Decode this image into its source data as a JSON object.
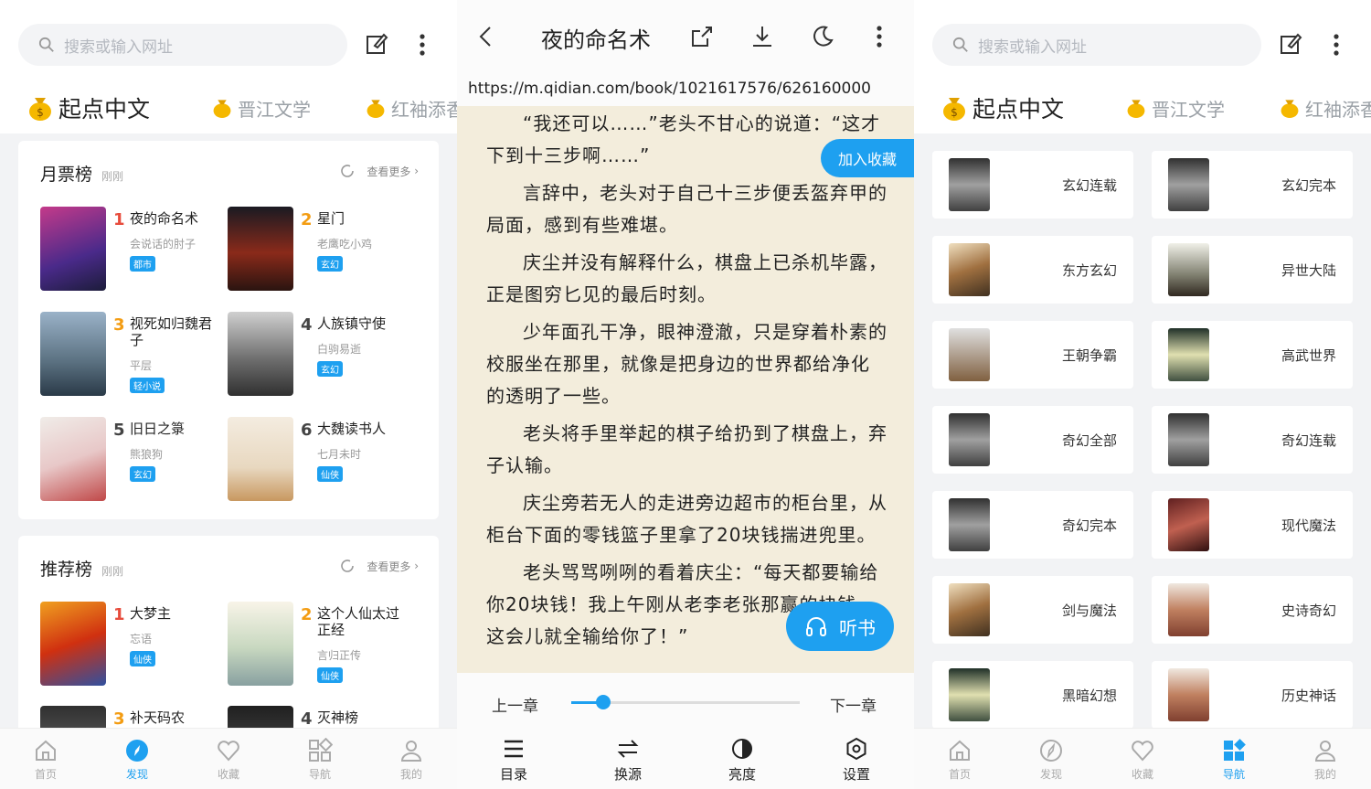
{
  "panel1": {
    "search_placeholder": "搜索或输入网址",
    "sources": [
      "起点中文",
      "晋江文学",
      "红袖添香"
    ],
    "monthly": {
      "title": "月票榜",
      "time": "刚刚",
      "more": "查看更多",
      "books": [
        {
          "rank": "1",
          "title": "夜的命名术",
          "author": "会说话的肘子",
          "tag": "都市"
        },
        {
          "rank": "2",
          "title": "星门",
          "author": "老鹰吃小鸡",
          "tag": "玄幻"
        },
        {
          "rank": "3",
          "title": "视死如归魏君子",
          "author": "平层",
          "tag": "轻小说"
        },
        {
          "rank": "4",
          "title": "人族镇守使",
          "author": "白驹易逝",
          "tag": "玄幻"
        },
        {
          "rank": "5",
          "title": "旧日之箓",
          "author": "熊狼狗",
          "tag": "玄幻"
        },
        {
          "rank": "6",
          "title": "大魏读书人",
          "author": "七月未时",
          "tag": "仙侠"
        }
      ]
    },
    "recommend": {
      "title": "推荐榜",
      "time": "刚刚",
      "more": "查看更多",
      "books": [
        {
          "rank": "1",
          "title": "大梦主",
          "author": "忘语",
          "tag": "仙侠"
        },
        {
          "rank": "2",
          "title": "这个人仙太过正经",
          "author": "言归正传",
          "tag": "仙侠"
        },
        {
          "rank": "3",
          "title": "补天码农",
          "author": "",
          "tag": ""
        },
        {
          "rank": "4",
          "title": "灭神榜",
          "author": "",
          "tag": ""
        }
      ]
    },
    "nav": [
      "首页",
      "发现",
      "收藏",
      "导航",
      "我的"
    ]
  },
  "panel2": {
    "title": "夜的命名术",
    "url": "https://m.qidian.com/book/1021617576/626160000",
    "paragraphs": [
      "“我还可以……”老头不甘心的说道：“这才下到十三步啊……”",
      "言辞中，老头对于自己十三步便丢盔弃甲的局面，感到有些难堪。",
      "庆尘并没有解释什么，棋盘上已杀机毕露，正是图穷匕见的最后时刻。",
      "少年面孔干净，眼神澄澈，只是穿着朴素的校服坐在那里，就像是把身边的世界都给净化的透明了一些。",
      "老头将手里举起的棋子给扔到了棋盘上，弃子认输。",
      "庆尘旁若无人的走进旁边超市的柜台里，从柜台下面的零钱篮子里拿了20块钱揣进兜里。",
      "老头骂骂咧咧的看着庆尘：“每天都要输给你20块钱！我上午刚从老李老张那赢的块钱，这会儿就全输给你了！”"
    ],
    "collect": "加入收藏",
    "listen": "听书",
    "prev": "上一章",
    "next": "下一章",
    "progress": 0.14,
    "tools": [
      "目录",
      "换源",
      "亮度",
      "设置"
    ]
  },
  "panel3": {
    "search_placeholder": "搜索或输入网址",
    "sources": [
      "起点中文",
      "晋江文学",
      "红袖添香"
    ],
    "categories": [
      "玄幻连载",
      "玄幻完本",
      "东方玄幻",
      "异世大陆",
      "王朝争霸",
      "高武世界",
      "奇幻全部",
      "奇幻连载",
      "奇幻完本",
      "现代魔法",
      "剑与魔法",
      "史诗奇幻",
      "黑暗幻想",
      "历史神话"
    ],
    "nav": [
      "首页",
      "发现",
      "收藏",
      "导航",
      "我的"
    ]
  },
  "colors": {
    "accent": "#1ea0f0",
    "rank_red": "#e74c3c",
    "rank_orange": "#f39c12"
  }
}
